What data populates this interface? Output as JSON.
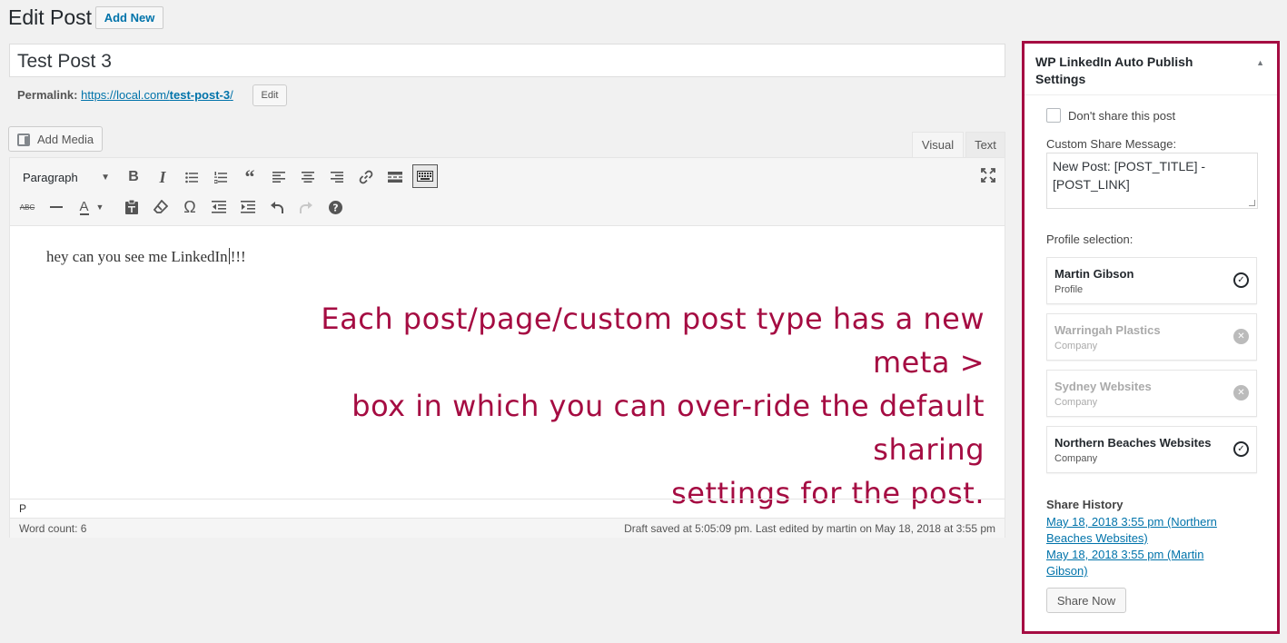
{
  "header": {
    "title": "Edit Post",
    "add_new_label": "Add New"
  },
  "post": {
    "title_value": "Test Post 3",
    "permalink_label": "Permalink:",
    "permalink_base": "https://local.com/",
    "permalink_slug": "test-post-3",
    "permalink_trail": "/",
    "edit_label": "Edit"
  },
  "editor": {
    "add_media_label": "Add Media",
    "tabs": {
      "visual": "Visual",
      "text": "Text"
    },
    "format_select": "Paragraph",
    "content_before_caret": "hey can you see me LinkedIn",
    "content_after_caret": "!!!",
    "path": "P",
    "word_count": "Word count: 6",
    "save_status": "Draft saved at 5:05:09 pm. Last edited by martin on May 18, 2018 at 3:55 pm"
  },
  "callout": {
    "line1": "Each post/page/custom post type has a new meta >",
    "line2": "box in which you can over-ride the default sharing",
    "line3": "settings for the post.",
    "color": "#a50c42"
  },
  "metabox": {
    "title": "WP LinkedIn Auto Publish Settings",
    "dont_share_label": "Don't share this post",
    "custom_message_label": "Custom Share Message:",
    "custom_message_value": "New Post: [POST_TITLE] - [POST_LINK]",
    "profile_selection_label": "Profile selection:",
    "profiles": [
      {
        "name": "Martin Gibson",
        "type": "Profile",
        "selected": true
      },
      {
        "name": "Warringah Plastics",
        "type": "Company",
        "selected": false
      },
      {
        "name": "Sydney Websites",
        "type": "Company",
        "selected": false
      },
      {
        "name": "Northern Beaches Websites",
        "type": "Company",
        "selected": true
      }
    ],
    "share_history_label": "Share History",
    "history": [
      "May 18, 2018 3:55 pm (Northern Beaches Websites)",
      "May 18, 2018 3:55 pm (Martin Gibson)"
    ],
    "share_now_label": "Share Now",
    "border_color": "#a50c42"
  }
}
